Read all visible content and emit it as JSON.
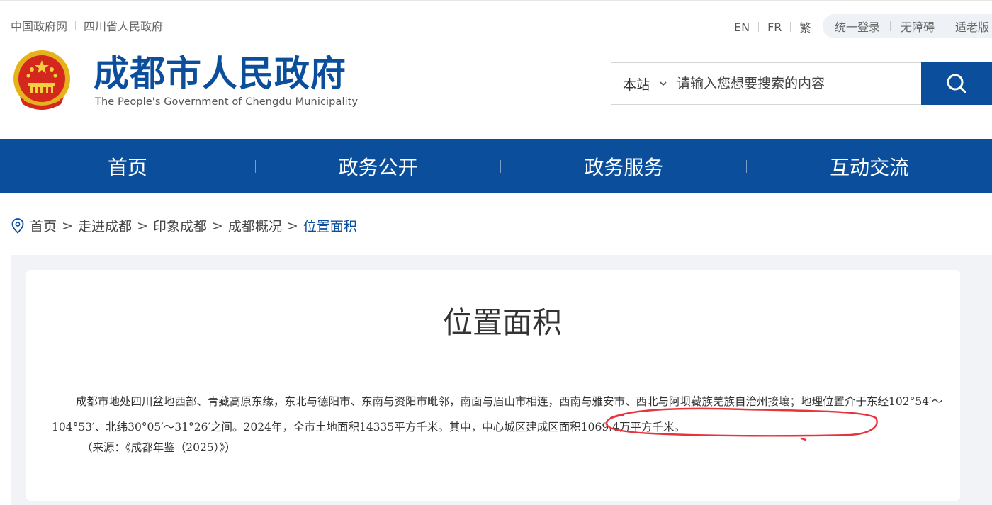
{
  "top_links": [
    "中国政府网",
    "四川省人民政府"
  ],
  "languages": [
    "EN",
    "FR",
    "繁"
  ],
  "utility_links": [
    "统一登录",
    "无障碍",
    "适老版"
  ],
  "site": {
    "title": "成都市人民政府",
    "subtitle": "The People's Government of Chengdu Municipality"
  },
  "search": {
    "scope": "本站",
    "placeholder": "请输入您想要搜索的内容"
  },
  "nav": [
    "首页",
    "政务公开",
    "政务服务",
    "互动交流"
  ],
  "breadcrumb": [
    "首页",
    "走进成都",
    "印象成都",
    "成都概况",
    "位置面积"
  ],
  "article": {
    "title": "位置面积",
    "body_part1": "成都市地处四川盆地西部、青藏高原东缘，东北与德阳市、东南与资阳市毗邻，南面与眉山市相连，西南与雅安市、西北与阿坝藏族羌族自治州接壤；地理位置介于东经102°54′～104°53′、北纬30°05′～31°26′之间。2024年，全市土地面积14335平方千米。",
    "body_highlight": "其中，中心城区建成区面积1069.4万平方千米。",
    "source": "（来源：《成都年鉴（2025）》）"
  },
  "colors": {
    "brand_blue": "#0b4f9c",
    "annotation_red": "#e8323c"
  }
}
